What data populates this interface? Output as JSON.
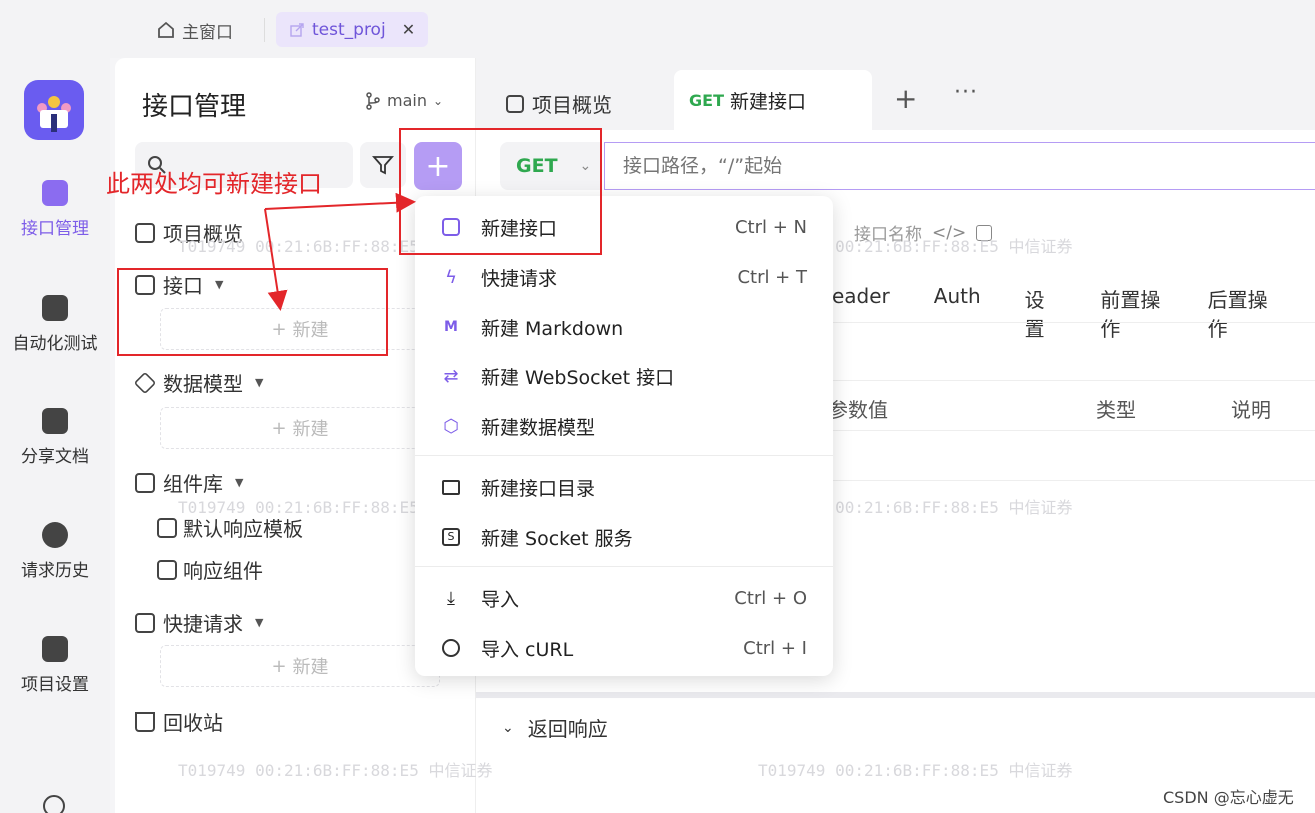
{
  "titlebar": {
    "home_label": "主窗口",
    "project_tab": "test_proj"
  },
  "rail": {
    "items": [
      {
        "label": "接口管理",
        "active": true
      },
      {
        "label": "自动化测试"
      },
      {
        "label": "分享文档"
      },
      {
        "label": "请求历史"
      },
      {
        "label": "项目设置"
      }
    ]
  },
  "panel": {
    "title": "接口管理",
    "branch": "main",
    "tree": {
      "overview": "项目概览",
      "api": "接口",
      "new_label": "新建",
      "data_model": "数据模型",
      "components": "组件库",
      "default_template": "默认响应模板",
      "response_component": "响应组件",
      "quick_request": "快捷请求",
      "trash": "回收站"
    }
  },
  "main": {
    "tabs": {
      "overview": "项目概览",
      "active_method": "GET",
      "active_label": "新建接口"
    },
    "method": "GET",
    "url_placeholder": "接口路径，“/”起始",
    "name_placeholder": "接口名称",
    "sub_tabs": [
      "eader",
      "Auth",
      "设置",
      "前置操作",
      "后置操作"
    ],
    "columns": {
      "value": "参数值",
      "type": "类型",
      "desc": "说明"
    },
    "response_title": "返回响应"
  },
  "menu": {
    "items": [
      {
        "label": "新建接口",
        "shortcut": "Ctrl + N"
      },
      {
        "label": "快捷请求",
        "shortcut": "Ctrl + T"
      },
      {
        "label": "新建 Markdown",
        "shortcut": ""
      },
      {
        "label": "新建 WebSocket 接口",
        "shortcut": ""
      },
      {
        "label": "新建数据模型",
        "shortcut": ""
      },
      {
        "label": "新建接口目录",
        "shortcut": ""
      },
      {
        "label": "新建 Socket 服务",
        "shortcut": ""
      },
      {
        "label": "导入",
        "shortcut": "Ctrl + O"
      },
      {
        "label": "导入 cURL",
        "shortcut": "Ctrl + I"
      }
    ]
  },
  "annotation": {
    "text": "此两处均可新建接口"
  },
  "watermark": {
    "text": "T019749  00:21:6B:FF:88:E5  中信证券"
  },
  "credit": "CSDN @忘心虚无",
  "colors": {
    "accent": "#7d5de8",
    "get_method": "#2fa84f",
    "annotation": "#e3262a"
  }
}
